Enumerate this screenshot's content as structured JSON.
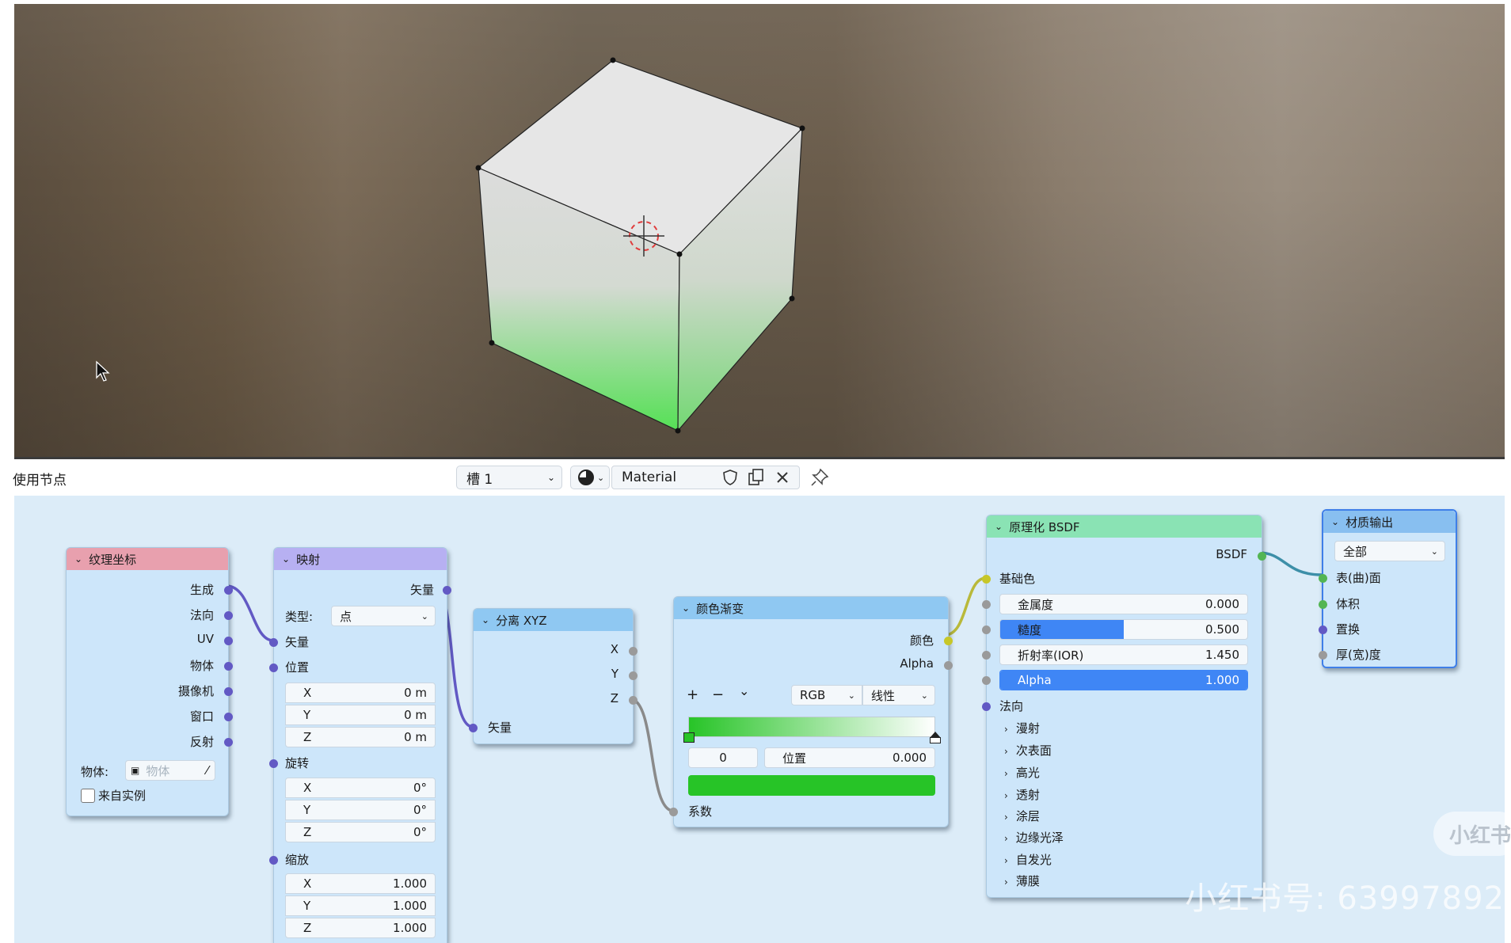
{
  "header": {
    "use_nodes_label": "使用节点",
    "slot_label": "槽 1",
    "material_name": "Material"
  },
  "nodes": {
    "tex_coord": {
      "title": "纹理坐标",
      "outputs": [
        "生成",
        "法向",
        "UV",
        "物体",
        "摄像机",
        "窗口",
        "反射"
      ],
      "object_label": "物体:",
      "object_placeholder": "物体",
      "from_instance_label": "来自实例"
    },
    "mapping": {
      "title": "映射",
      "output_vector": "矢量",
      "type_label": "类型:",
      "type_value": "点",
      "input_vector": "矢量",
      "location_label": "位置",
      "location": [
        {
          "axis": "X",
          "value": "0 m"
        },
        {
          "axis": "Y",
          "value": "0 m"
        },
        {
          "axis": "Z",
          "value": "0 m"
        }
      ],
      "rotation_label": "旋转",
      "rotation": [
        {
          "axis": "X",
          "value": "0°"
        },
        {
          "axis": "Y",
          "value": "0°"
        },
        {
          "axis": "Z",
          "value": "0°"
        }
      ],
      "scale_label": "缩放",
      "scale": [
        {
          "axis": "X",
          "value": "1.000"
        },
        {
          "axis": "Y",
          "value": "1.000"
        },
        {
          "axis": "Z",
          "value": "1.000"
        }
      ]
    },
    "separate_xyz": {
      "title": "分离 XYZ",
      "outputs": [
        "X",
        "Y",
        "Z"
      ],
      "input_vector": "矢量"
    },
    "color_ramp": {
      "title": "颜色渐变",
      "output_color": "颜色",
      "output_alpha": "Alpha",
      "add": "+",
      "remove": "−",
      "menu": "⌄",
      "color_mode": "RGB",
      "interpolation": "线性",
      "stop_index": "0",
      "position_label": "位置",
      "position_value": "0.000",
      "input_fac": "系数",
      "stop_color": "#27c427"
    },
    "bsdf": {
      "title": "原理化 BSDF",
      "output": "BSDF",
      "base_color": "基础色",
      "fields": [
        {
          "label": "金属度",
          "value": "0.000",
          "fill": 0
        },
        {
          "label": "糙度",
          "value": "0.500",
          "fill": 0.5
        },
        {
          "label": "折射率(IOR)",
          "value": "1.450",
          "fill": 0
        },
        {
          "label": "Alpha",
          "value": "1.000",
          "fill": 1
        }
      ],
      "normal": "法向",
      "panels": [
        "漫射",
        "次表面",
        "高光",
        "透射",
        "涂层",
        "边缘光泽",
        "自发光",
        "薄膜"
      ]
    },
    "material_output": {
      "title": "材质输出",
      "target": "全部",
      "inputs": [
        "表(曲)面",
        "体积",
        "置换",
        "厚(宽)度"
      ]
    }
  },
  "watermark": "小红书号: 63997892",
  "badge": "小红书",
  "colors": {
    "tex_coord_header": "#e8a0ae",
    "mapping_header": "#b7b0f2",
    "separate_header": "#8fc8f2",
    "ramp_header": "#8fc8f2",
    "bsdf_header": "#8ae3b4",
    "output_header": "#88bff0",
    "selection": "#3f86f5"
  }
}
